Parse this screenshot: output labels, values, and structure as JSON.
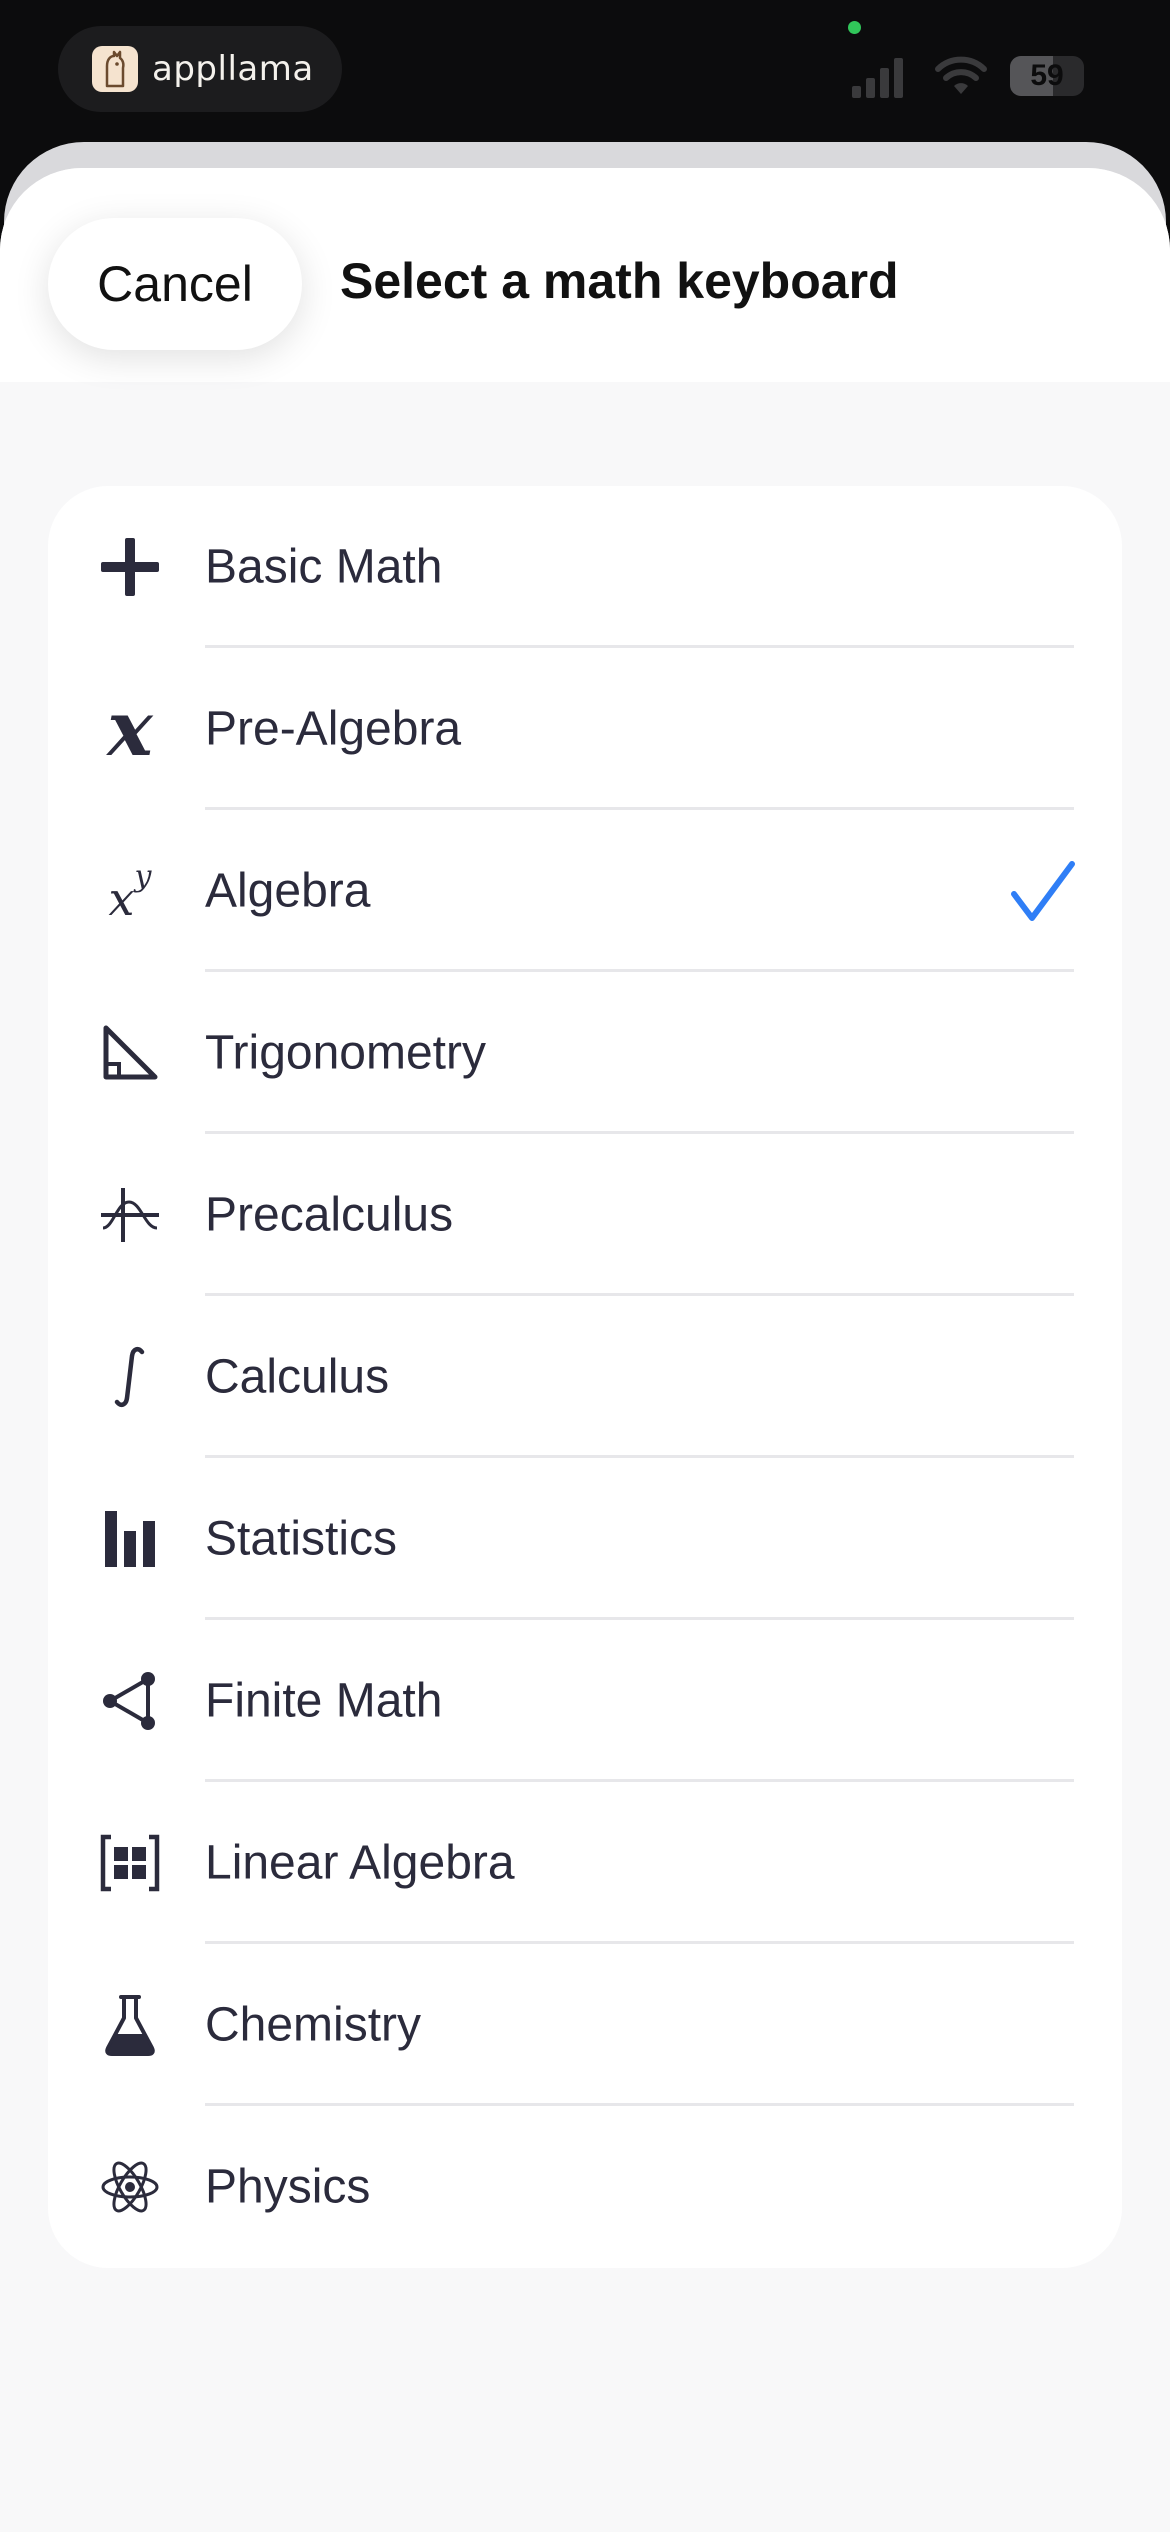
{
  "status_bar": {
    "app_name": "appllama",
    "battery": "59"
  },
  "sheet": {
    "cancel_label": "Cancel",
    "title": "Select a math keyboard"
  },
  "keyboards": [
    {
      "label": "Basic Math",
      "icon": "plus-icon"
    },
    {
      "label": "Pre-Algebra",
      "icon": "variable-x-icon"
    },
    {
      "label": "Algebra",
      "icon": "x-power-y-icon",
      "selected": true
    },
    {
      "label": "Trigonometry",
      "icon": "right-triangle-icon"
    },
    {
      "label": "Precalculus",
      "icon": "function-graph-icon"
    },
    {
      "label": "Calculus",
      "icon": "integral-icon"
    },
    {
      "label": "Statistics",
      "icon": "bar-chart-icon"
    },
    {
      "label": "Finite Math",
      "icon": "graph-nodes-icon"
    },
    {
      "label": "Linear Algebra",
      "icon": "matrix-icon"
    },
    {
      "label": "Chemistry",
      "icon": "flask-icon"
    },
    {
      "label": "Physics",
      "icon": "atom-icon"
    }
  ],
  "colors": {
    "accent": "#2f7ef6",
    "text": "#2b2b3c",
    "divider": "#e7e7ea"
  }
}
